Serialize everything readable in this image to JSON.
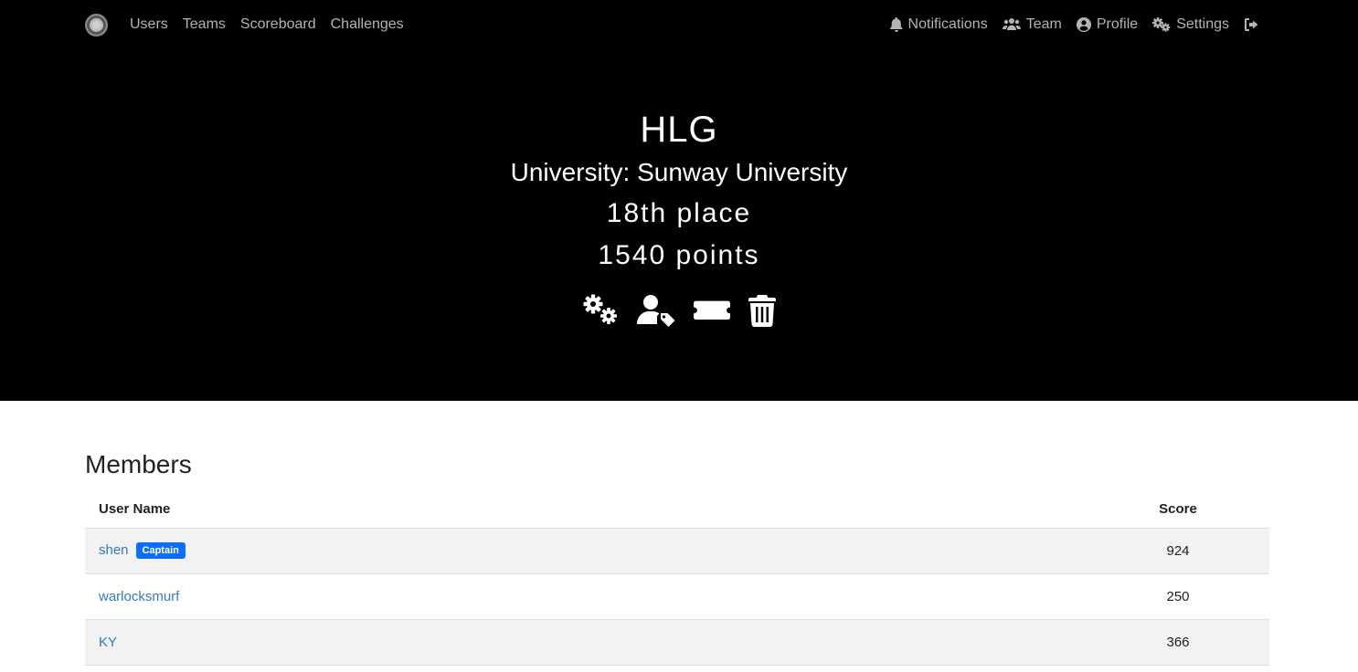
{
  "nav": {
    "left": [
      "Users",
      "Teams",
      "Scoreboard",
      "Challenges"
    ],
    "notifications": "Notifications",
    "team": "Team",
    "profile": "Profile",
    "settings": "Settings"
  },
  "team": {
    "name": "HLG",
    "affiliation": "University: Sunway University",
    "place": "18th place",
    "points": "1540 points"
  },
  "members": {
    "title": "Members",
    "columns": [
      "User Name",
      "Score"
    ],
    "rows": [
      {
        "name": "shen",
        "badge": "Captain",
        "score": "924"
      },
      {
        "name": "warlocksmurf",
        "badge": "",
        "score": "250"
      },
      {
        "name": "KY",
        "badge": "",
        "score": "366"
      }
    ]
  },
  "icons": {
    "hero": [
      "gears-icon",
      "user-tag-icon",
      "ticket-icon",
      "trash-icon"
    ],
    "nav": [
      "bell-icon",
      "users-icon",
      "user-circle-icon",
      "cogs-icon",
      "sign-out-icon"
    ]
  },
  "colors": {
    "hero_bg": "#000000",
    "link": "#337ab7",
    "captain_badge": "#0d6efd"
  }
}
